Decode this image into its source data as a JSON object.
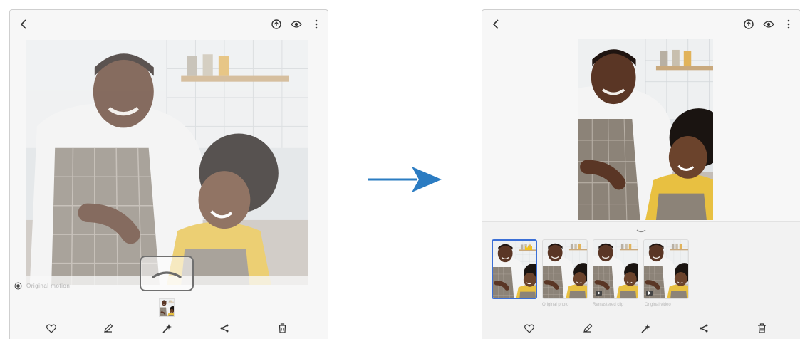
{
  "left_screen": {
    "top_icons": [
      "back-icon",
      "remaster-icon",
      "eye-icon",
      "more-vert-icon"
    ],
    "motion_label": "Original motion",
    "action_bar": [
      "heart-icon",
      "pencil-icon",
      "sparkle-icon",
      "share-icon",
      "trash-icon"
    ]
  },
  "right_screen": {
    "top_icons": [
      "back-icon",
      "remaster-icon",
      "eye-icon",
      "more-vert-icon"
    ],
    "thumbnails": [
      {
        "caption": "",
        "selected": true,
        "badge": "crown-icon"
      },
      {
        "caption": "Original photo",
        "selected": false
      },
      {
        "caption": "Remastered clip",
        "selected": false,
        "badge": "video-icon"
      },
      {
        "caption": "Original video",
        "selected": false,
        "badge": "video-icon"
      }
    ],
    "action_bar": [
      "heart-icon",
      "pencil-icon",
      "sparkle-icon",
      "share-icon",
      "trash-icon"
    ]
  },
  "colors": {
    "arrow": "#2b7cc2",
    "selection": "#3b6fd6",
    "highlight_frame": "#707070"
  }
}
